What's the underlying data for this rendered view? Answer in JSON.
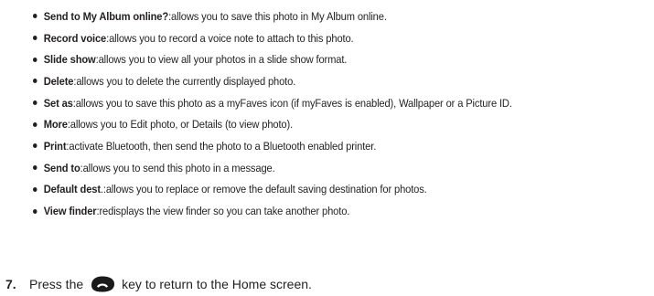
{
  "options": [
    {
      "term": "Send to My Album online?",
      "suffix": ":",
      "desc": " allows you to save this photo in My Album online."
    },
    {
      "term": "Record voice",
      "suffix": ":",
      "desc": " allows you to record a voice note to attach to this photo."
    },
    {
      "term": "Slide show",
      "suffix": ":",
      "desc": " allows you to view all your photos in a slide show format."
    },
    {
      "term": "Delete",
      "suffix": ":",
      "desc": " allows you to delete the currently displayed photo."
    },
    {
      "term": "Set as",
      "suffix": ":",
      "desc": " allows you to save this photo as a myFaves icon (if myFaves is enabled), Wallpaper or a Picture ID."
    },
    {
      "term": "More",
      "suffix": ":",
      "desc": " allows you to Edit photo, or Details (to view photo)."
    },
    {
      "term": "Print",
      "suffix": ":",
      "desc": " activate Bluetooth, then send the photo to a Bluetooth enabled printer."
    },
    {
      "term": "Send to",
      "suffix": ":",
      "desc": " allows you to send this photo in a message."
    },
    {
      "term": "Default dest",
      "suffix": ".:",
      "desc": " allows you to replace or remove the default saving destination for photos."
    },
    {
      "term": "View finder",
      "suffix": ":",
      "desc": " redisplays the view finder so you can take another photo."
    }
  ],
  "step": {
    "number": "7.",
    "before_key": "Press the",
    "key_icon": "end-key-icon",
    "after_key": "key to return to the Home screen."
  },
  "colors": {
    "text": "#231f20",
    "key_fill": "#1a1a1a",
    "key_glyph": "#ffffff"
  }
}
